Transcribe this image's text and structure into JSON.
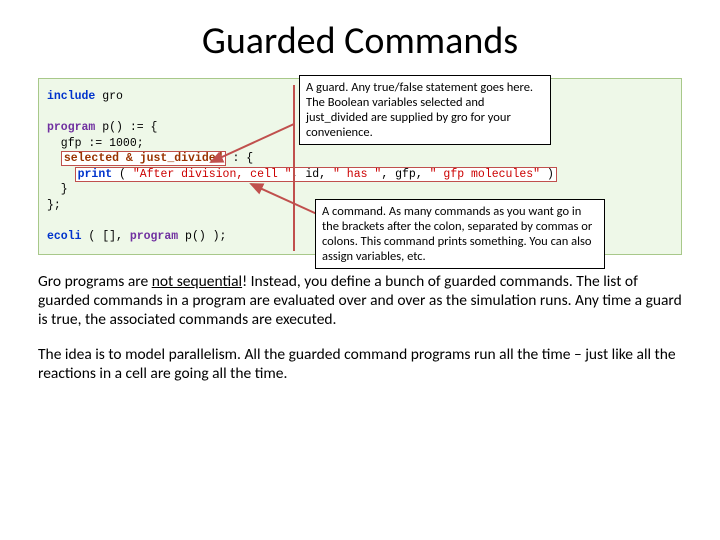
{
  "title": "Guarded Commands",
  "code": {
    "l1a": "include",
    "l1b": " gro",
    "l2a": "program",
    "l2b": " p() := {",
    "l3": "  gfp := 1000;",
    "l4g": "selected & just_divided",
    "l4r": " : {",
    "l5a": "print",
    "l5b": " ( ",
    "l5c": "\"After division, cell \"",
    "l5d": ", id, ",
    "l5e": "\" has \"",
    "l5f": ", gfp, ",
    "l5g": "\" gfp molecules\"",
    "l5h": " )",
    "l6": "  }",
    "l7": "};",
    "l8a": "ecoli",
    "l8b": " ( [], ",
    "l8c": "program",
    "l8d": " p() );"
  },
  "callout_guard": "A guard. Any true/false statement goes here. The Boolean variables selected and just_divided are supplied by gro for your convenience.",
  "callout_cmd": "A command. As many commands as you want go in the brackets after the colon, separated by commas or colons. This command prints something. You can also assign variables, etc.",
  "para1a": "Gro programs are ",
  "para1b": "not sequential",
  "para1c": "! Instead, you define a bunch of guarded commands. The list of guarded commands in a program are evaluated over and over as the simulation runs. Any time a guard is true, the associated commands are executed.",
  "para2": "The idea is to model parallelism. All the guarded command programs run all the time – just like all the reactions in a cell are going all the time."
}
